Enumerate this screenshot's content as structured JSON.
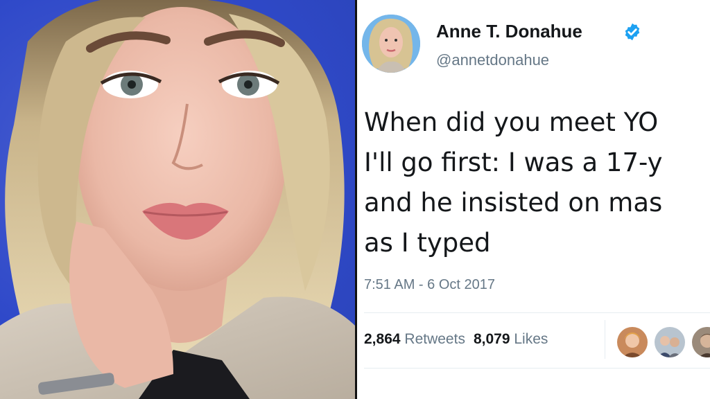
{
  "tweet": {
    "display_name": "Anne T. Donahue",
    "handle": "@annetdonahue",
    "text_lines": [
      "When did you meet YO",
      "I'll go first: I was a 17-y",
      "and he insisted on mas",
      "as I typed"
    ],
    "timestamp": "7:51 AM - 6 Oct 2017",
    "retweets_count": "2,864",
    "retweets_label": "Retweets",
    "likes_count": "8,079",
    "likes_label": "Likes"
  },
  "icons": {
    "verified": "verified-badge-icon"
  },
  "colors": {
    "verified_blue": "#1da1f2",
    "text_dark": "#14171a",
    "text_muted": "#657786",
    "photo_background_blue": "#2f49c9"
  }
}
